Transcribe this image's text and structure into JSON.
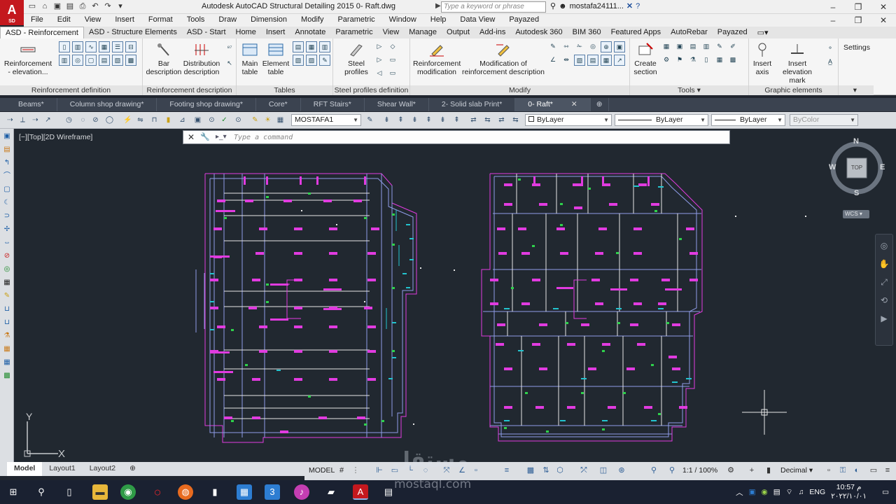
{
  "app": {
    "logo_text": "A",
    "logo_sub": "SD",
    "title": "Autodesk AutoCAD Structural Detailing 2015    0- Raft.dwg",
    "search_placeholder": "Type a keyword or phrase",
    "user": "mostafa24111..."
  },
  "menu": [
    "File",
    "Edit",
    "View",
    "Insert",
    "Format",
    "Tools",
    "Draw",
    "Dimension",
    "Modify",
    "Parametric",
    "Window",
    "Help",
    "Data View",
    "Payazed"
  ],
  "ribbon_tabs": [
    "ASD - Reinforcement",
    "ASD - Structure Elements",
    "ASD - Start",
    "Home",
    "Insert",
    "Annotate",
    "Parametric",
    "View",
    "Manage",
    "Output",
    "Add-ins",
    "Autodesk 360",
    "BIM 360",
    "Featured Apps",
    "AutoRebar",
    "Payazed"
  ],
  "ribbon": {
    "reinforcement_definition": {
      "title": "Reinforcement definition",
      "elevation_btn": "Reinforcement - elevation..."
    },
    "reinforcement_description": {
      "title": "Reinforcement description",
      "bar_btn": "Bar description",
      "distribution_btn": "Distribution description"
    },
    "tables": {
      "title": "Tables",
      "main_btn": "Main table",
      "element_btn": "Element table"
    },
    "steel_profiles": {
      "title": "Steel profiles definition",
      "steel_btn": "Steel profiles"
    },
    "modify": {
      "title": "Modify",
      "reinf_mod_btn": "Reinforcement modification",
      "mod_desc_btn": "Modification of reinforcement description"
    },
    "tools": {
      "title": "Tools",
      "create_section_btn": "Create section"
    },
    "graphic": {
      "title": "Graphic elements",
      "insert_axis_btn": "Insert axis",
      "insert_elev_btn": "Insert elevation mark"
    },
    "settings": "Settings"
  },
  "file_tabs": [
    "Beams*",
    "Column shop drawing*",
    "Footing shop drawing*",
    "Core*",
    "RFT Stairs*",
    "Shear Wall*",
    "2- Solid slab Print*",
    "0- Raft*"
  ],
  "properties": {
    "layer": "MOSTAFA1",
    "color": "ByLayer",
    "linetype": "ByLayer",
    "lineweight": "ByLayer",
    "plotstyle": "ByColor"
  },
  "viewport": {
    "label": "[−][Top][2D Wireframe]",
    "command_placeholder": "Type a command"
  },
  "viewcube": {
    "n": "N",
    "s": "S",
    "e": "E",
    "w": "W",
    "top": "TOP",
    "wcs": "WCS"
  },
  "ucs": {
    "x": "X",
    "y": "Y"
  },
  "layout_tabs": [
    "Model",
    "Layout1",
    "Layout2"
  ],
  "status": {
    "model": "MODEL",
    "scale": "1:1 / 100%",
    "units": "Decimal"
  },
  "taskbar": {
    "time": "10:57 م",
    "date": "٢٠٢٢/١٠/٠١",
    "lang": "ENG"
  },
  "watermark": {
    "arabic": "مستقل",
    "latin": "mostaql.com"
  },
  "colors": {
    "magenta": "#e13be0",
    "blue": "#8f9ce8",
    "cyan": "#23c4cf",
    "green": "#2fd14c",
    "white": "#e6e6e6",
    "background": "#212830"
  }
}
